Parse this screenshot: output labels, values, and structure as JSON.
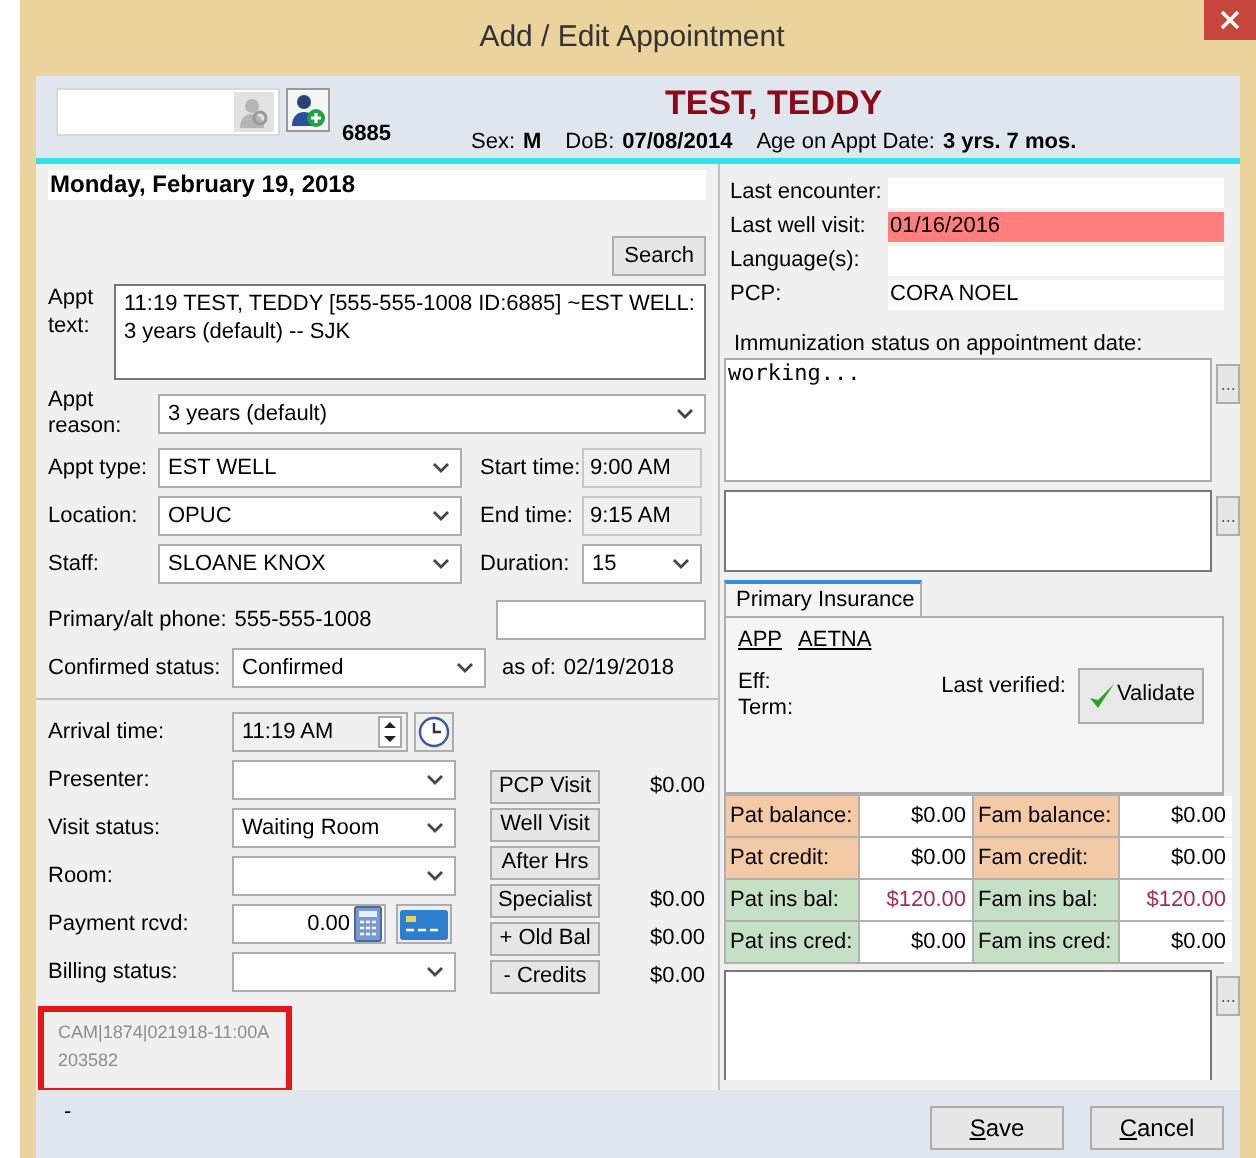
{
  "window": {
    "title": "Add / Edit Appointment"
  },
  "header": {
    "patient_id": "6885",
    "patient_name": "TEST, TEDDY",
    "sex_label": "Sex:",
    "sex": "M",
    "dob_label": "DoB:",
    "dob": "07/08/2014",
    "age_label": "Age on Appt Date:",
    "age": "3 yrs. 7 mos."
  },
  "appointment": {
    "date": "Monday, February 19, 2018",
    "search_button": "Search",
    "appt_text_label": "Appt text:",
    "appt_text": "11:19 TEST, TEDDY  [555-555-1008 ID:6885] ~EST WELL: 3 years (default) -- SJK",
    "reason_label": "Appt reason:",
    "reason": "3 years (default)",
    "type_label": "Appt type:",
    "type": "EST WELL",
    "start_label": "Start time:",
    "start": "9:00 AM",
    "location_label": "Location:",
    "location": "OPUC",
    "end_label": "End time:",
    "end": "9:15 AM",
    "staff_label": "Staff:",
    "staff": "SLOANE KNOX",
    "duration_label": "Duration:",
    "duration": "15",
    "phone_label": "Primary/alt phone:",
    "phone": "555-555-1008",
    "confirmed_label": "Confirmed status:",
    "confirmed": "Confirmed",
    "as_of_label": "as of:",
    "as_of": "02/19/2018"
  },
  "visit": {
    "arrival_label": "Arrival time:",
    "arrival": "11:19 AM",
    "presenter_label": "Presenter:",
    "status_label": "Visit status:",
    "status": "Waiting Room",
    "room_label": "Room:",
    "payment_label": "Payment rcvd:",
    "payment": "0.00",
    "billing_label": "Billing status:"
  },
  "charges": [
    {
      "button": "PCP Visit",
      "amount": "$0.00"
    },
    {
      "button": "Well Visit"
    },
    {
      "button": "After Hrs"
    },
    {
      "button": "Specialist",
      "amount": "$0.00"
    },
    {
      "button": "+ Old Bal",
      "amount": "$0.00"
    },
    {
      "button": "- Credits",
      "amount": "$0.00"
    }
  ],
  "footnote": [
    "CAM|1874|021918-11:00A",
    "203582"
  ],
  "status_dash": "-",
  "patient_info": [
    {
      "label": "Last encounter:",
      "alert": false
    },
    {
      "label": "Last well visit:",
      "value": "01/16/2016",
      "alert": true
    },
    {
      "label": "Language(s):",
      "alert": false
    },
    {
      "label": "PCP:",
      "value": "CORA NOEL",
      "alert": false
    }
  ],
  "immunization": {
    "label": "Immunization status on appointment date:",
    "text": "working...",
    "more_button": "..."
  },
  "notes_more_button": "...",
  "insurance": {
    "tab": "Primary Insurance",
    "plan_links": [
      "APP",
      "AETNA"
    ],
    "eff_label": "Eff:",
    "term_label": "Term:",
    "last_verified_label": "Last verified:",
    "validate_button": "Validate"
  },
  "balances": [
    {
      "kind": "account",
      "cells": [
        {
          "label": "Pat balance:",
          "value": "$0.00",
          "due": false
        },
        {
          "label": "Fam balance:",
          "value": "$0.00",
          "due": false
        }
      ]
    },
    {
      "kind": "account",
      "cells": [
        {
          "label": "Pat credit:",
          "value": "$0.00",
          "due": false
        },
        {
          "label": "Fam credit:",
          "value": "$0.00",
          "due": false
        }
      ]
    },
    {
      "kind": "insurance",
      "cells": [
        {
          "label": "Pat ins bal:",
          "value": "$120.00",
          "due": true
        },
        {
          "label": "Fam ins bal:",
          "value": "$120.00",
          "due": true
        }
      ]
    },
    {
      "kind": "insurance",
      "cells": [
        {
          "label": "Pat ins cred:",
          "value": "$0.00",
          "due": false
        },
        {
          "label": "Fam ins cred:",
          "value": "$0.00",
          "due": false
        }
      ]
    }
  ],
  "balances_more_button": "...",
  "buttons": [
    "Save",
    "Cancel"
  ]
}
